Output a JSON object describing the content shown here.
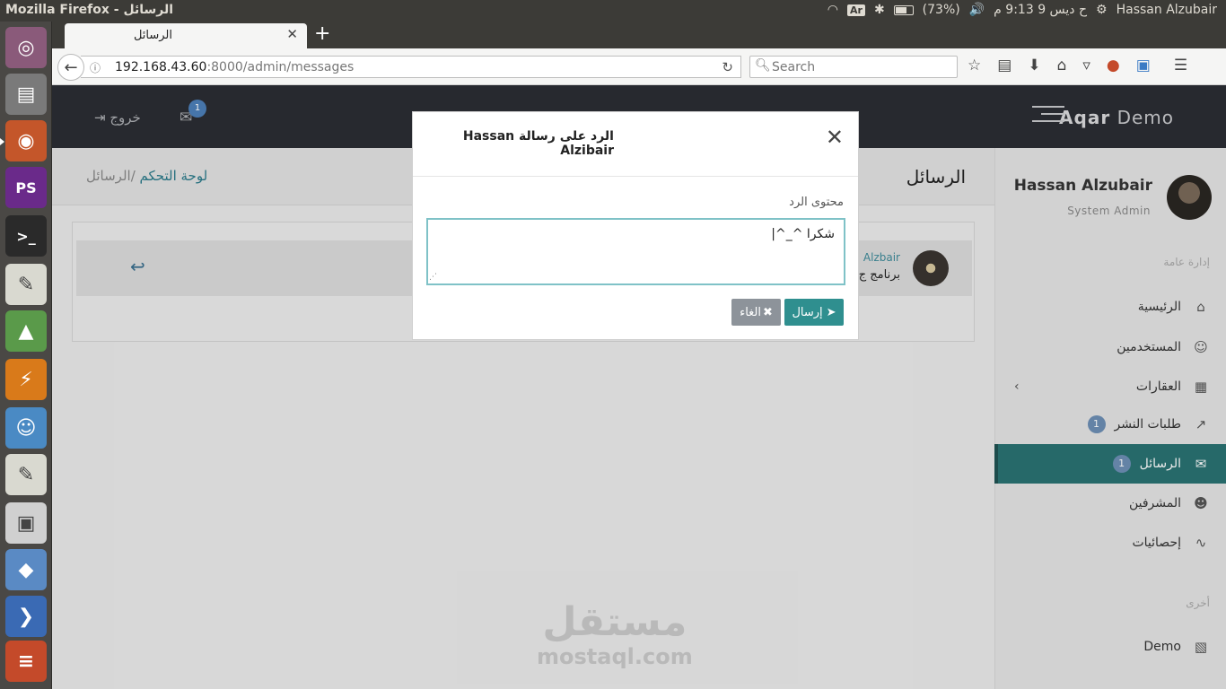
{
  "os": {
    "window_title": "Mozilla Firefox - الرسائل",
    "keyboard": "Ar",
    "battery": "(73%)",
    "battery_level": 0.73,
    "clock": "ح ديس  9  9:13 م",
    "user": "Hassan Alzubair"
  },
  "launcher": {
    "items": [
      "dash-icon",
      "files-icon",
      "firefox-icon",
      "phpstorm-icon",
      "terminal-icon",
      "text-editor-icon",
      "android-studio-icon",
      "flash-icon",
      "game-icon",
      "text-editor-icon",
      "screenshot-icon",
      "virtualbox-icon",
      "vscode-icon",
      "files-stack-icon"
    ]
  },
  "browser": {
    "tab_title": "الرسائل",
    "url_host": "192.168.43.60",
    "url_rest": ":8000/admin/messages",
    "search_placeholder": "Search"
  },
  "header": {
    "brand_bold": "Aqar",
    "brand_light": "Demo",
    "mail_badge": "1",
    "logout_label": "خروج"
  },
  "sidebar": {
    "user_name": "Hassan Alzubair",
    "user_role": "System Admin",
    "section_general": "إدارة عامة",
    "items": [
      {
        "label": "الرئيسية",
        "icon": "home-icon",
        "badge": ""
      },
      {
        "label": "المستخدمين",
        "icon": "user-icon",
        "badge": ""
      },
      {
        "label": "العقارات",
        "icon": "building-icon",
        "badge": ""
      },
      {
        "label": "طلبات النشر",
        "icon": "share-icon",
        "badge": "1"
      },
      {
        "label": "الرسائل",
        "icon": "envelope-icon",
        "badge": "1"
      },
      {
        "label": "المشرفين",
        "icon": "users-icon",
        "badge": ""
      },
      {
        "label": "إحصائيات",
        "icon": "chart-icon",
        "badge": ""
      }
    ],
    "section_other": "أخرى",
    "demo_label": "Demo"
  },
  "main": {
    "page_title": "الرسائل",
    "breadcrumb_home": "لوحة التحكم",
    "breadcrumb_current": "/الرسائل",
    "message_author": "Alzbair",
    "message_text": "برنامج ج"
  },
  "modal": {
    "title": "الرد على رسالة Hassan Alzibair",
    "field_label": "محتوى الرد",
    "reply_value": "شكرا ^_^|",
    "send_label": "إرسال",
    "cancel_label": "الغاء"
  },
  "watermark": {
    "arabic": "مستقل",
    "latin": "mostaql.com"
  }
}
